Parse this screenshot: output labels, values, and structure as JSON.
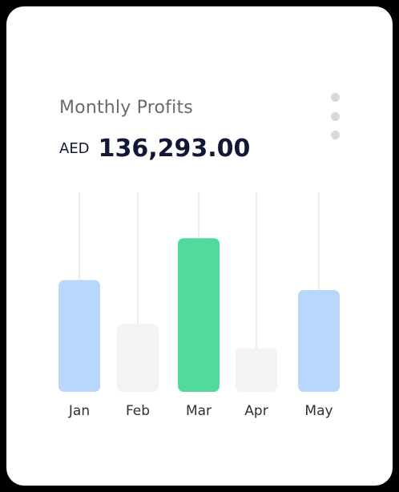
{
  "card": {
    "title": "Monthly Profits",
    "currency": "AED",
    "amount": "136,293.00",
    "menu_icon": "more-vertical-icon"
  },
  "colors": {
    "blue": "#b9d6fb",
    "green": "#52d99c",
    "gray": "#f3f3f3",
    "text_dark": "#121735",
    "text_muted": "#6b6b6b"
  },
  "chart_data": {
    "type": "bar",
    "categories": [
      "Jan",
      "Feb",
      "Mar",
      "Apr",
      "May"
    ],
    "values": [
      56,
      34,
      77,
      22,
      51
    ],
    "bar_colors": [
      "#b9d6fb",
      "#f3f3f3",
      "#52d99c",
      "#f3f3f3",
      "#b9d6fb"
    ],
    "title": "",
    "xlabel": "",
    "ylabel": "",
    "ylim": [
      0,
      100
    ],
    "grid": "vertical"
  }
}
